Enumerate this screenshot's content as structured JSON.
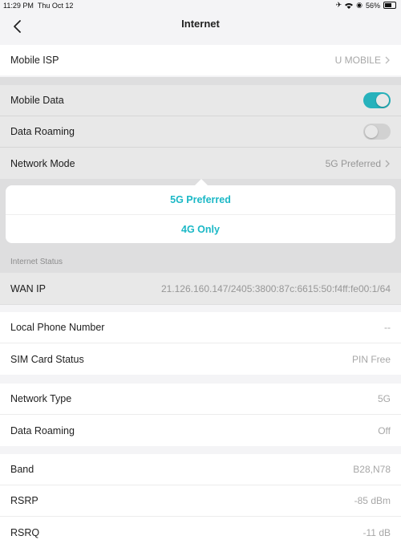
{
  "status_bar": {
    "time": "11:29 PM",
    "date": "Thu Oct 12",
    "battery": "56%"
  },
  "nav": {
    "title": "Internet"
  },
  "isp": {
    "label": "Mobile ISP",
    "value": "U MOBILE"
  },
  "mobile": {
    "mobile_data_label": "Mobile Data",
    "mobile_data_on": true,
    "data_roaming_label": "Data Roaming",
    "data_roaming_on": false,
    "network_mode_label": "Network Mode",
    "network_mode_value": "5G Preferred"
  },
  "popup": {
    "options": [
      "5G Preferred",
      "4G Only"
    ]
  },
  "internet_status": {
    "header": "Internet Status",
    "wan_ip_label": "WAN IP",
    "wan_ip_value": "21.126.160.147/2405:3800:87c:6615:50:f4ff:fe00:1/64"
  },
  "sim": {
    "phone_label": "Local Phone Number",
    "phone_value": "--",
    "sim_status_label": "SIM Card Status",
    "sim_status_value": "PIN Free"
  },
  "network": {
    "type_label": "Network Type",
    "type_value": "5G",
    "roaming_label": "Data Roaming",
    "roaming_value": "Off"
  },
  "signal": {
    "band_label": "Band",
    "band_value": "B28,N78",
    "rsrp_label": "RSRP",
    "rsrp_value": "-85 dBm",
    "rsrq_label": "RSRQ",
    "rsrq_value": "-11 dB"
  },
  "colors": {
    "accent": "#2bc4cf",
    "popup_text": "#1bb8c6"
  }
}
